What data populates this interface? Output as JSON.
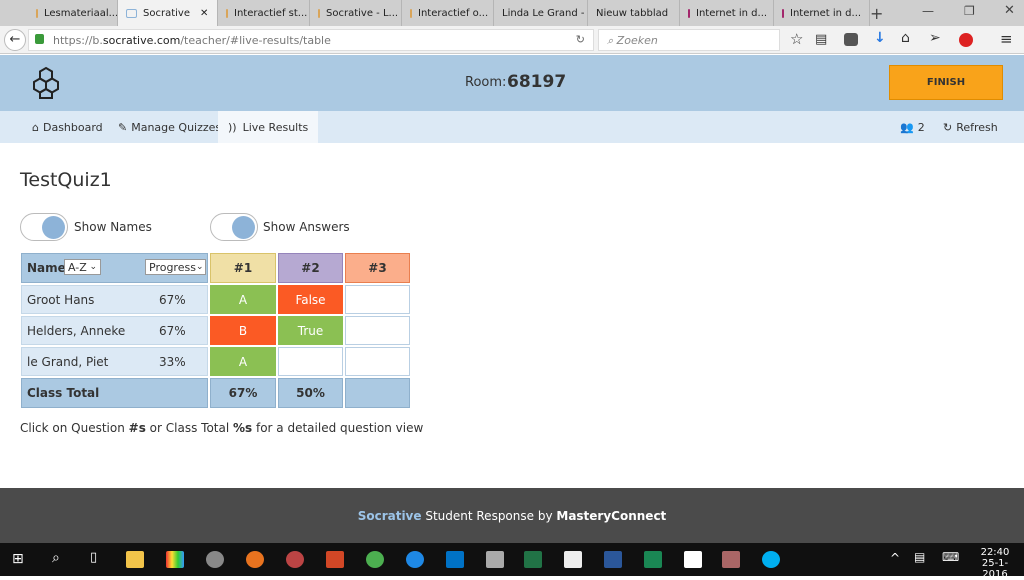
{
  "browser": {
    "tabs": [
      "Lesmateriaal...",
      "Socrative",
      "Interactief st...",
      "Socrative - L...",
      "Interactief o...",
      "Linda Le Grand - ...",
      "Nieuw tabblad",
      "Internet in d...",
      "Internet in d..."
    ],
    "active_tab": 1,
    "url_prefix": "https://b.",
    "url_domain": "socrative.com",
    "url_path": "/teacher/#live-results/table",
    "search_placeholder": "Zoeken"
  },
  "header": {
    "room_label": "Room:",
    "room_number": "68197",
    "finish": "FINISH"
  },
  "nav": {
    "dashboard": "Dashboard",
    "manage": "Manage Quizzes",
    "live": "Live Results",
    "students": "2",
    "refresh": "Refresh"
  },
  "main": {
    "title": "TestQuiz1",
    "show_names": "Show Names",
    "show_answers": "Show Answers",
    "table": {
      "name_header": "Name",
      "sort_value": "A-Z",
      "progress_value": "Progress",
      "questions": [
        "#1",
        "#2",
        "#3"
      ],
      "question_colors": [
        "#f0e0a6",
        "#b6a9d2",
        "#fbae8b"
      ],
      "rows": [
        {
          "name": "Groot Hans",
          "progress": "67%",
          "answers": [
            {
              "text": "A",
              "status": "correct"
            },
            {
              "text": "False",
              "status": "incorrect"
            },
            {
              "text": "",
              "status": "none"
            }
          ]
        },
        {
          "name": "Helders, Anneke",
          "progress": "67%",
          "answers": [
            {
              "text": "B",
              "status": "incorrect"
            },
            {
              "text": "True",
              "status": "correct"
            },
            {
              "text": "",
              "status": "none"
            }
          ]
        },
        {
          "name": "le Grand, Piet",
          "progress": "33%",
          "answers": [
            {
              "text": "A",
              "status": "correct"
            },
            {
              "text": "",
              "status": "none"
            },
            {
              "text": "",
              "status": "none"
            }
          ]
        }
      ],
      "total_label": "Class Total",
      "totals": [
        "67%",
        "50%",
        ""
      ]
    },
    "hint_1": "Click on Question ",
    "hint_b1": "#s",
    "hint_2": " or Class Total ",
    "hint_b2": "%s",
    "hint_3": " for a detailed question view"
  },
  "footer": {
    "brand": "Socrative",
    "middle": " Student Response by ",
    "company": "MasteryConnect"
  },
  "taskbar": {
    "time": "22:40",
    "date": "25-1-2016"
  }
}
